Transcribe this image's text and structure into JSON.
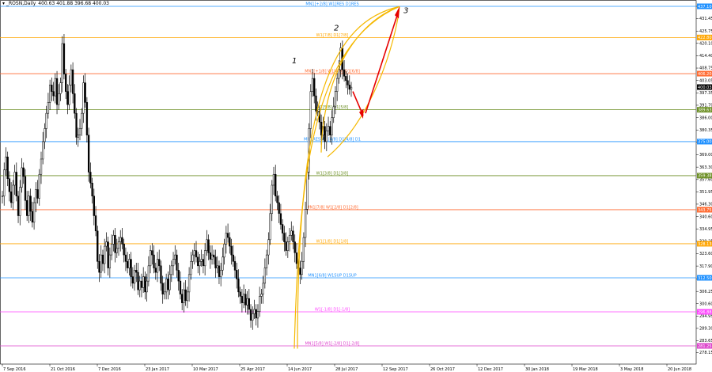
{
  "header": {
    "symbol": "_ROSN,Daily",
    "ohlc": "400.63 401.88 396.68 400.03",
    "arrow_glyph": "▾"
  },
  "chart_data": {
    "type": "candlestick",
    "symbol": "_ROSN",
    "timeframe": "Daily",
    "ylim": [
      272.9,
      440
    ],
    "y_ticks": [
      278.15,
      283.65,
      289.3,
      294.95,
      300.6,
      306.25,
      311.9,
      317.9,
      323.6,
      329.25,
      334.95,
      340.6,
      346.3,
      351.95,
      357.6,
      363.3,
      369.0,
      374.7,
      380.35,
      386.0,
      391.7,
      397.35,
      403.05,
      408.75,
      414.4,
      420.1,
      425.75,
      431.45,
      437.1
    ],
    "y_tick_labels": [
      "278.15",
      "283.65",
      "289.30",
      "294.95",
      "300.60",
      "306.25",
      "311.90",
      "317.90",
      "323.60",
      "329.25",
      "334.95",
      "340.60",
      "346.30",
      "351.95",
      "357.60",
      "363.30",
      "369.00",
      "374.70",
      "380.35",
      "386.00",
      "391.70",
      "397.35",
      "403.05",
      "408.75",
      "414.40",
      "420.10",
      "425.75",
      "431.45",
      "437.10"
    ],
    "x_tick_labels": [
      "7 Sep 2016",
      "21 Oct 2016",
      "7 Dec 2016",
      "23 Jan 2017",
      "10 Mar 2017",
      "25 Apr 2017",
      "14 Jun 2017",
      "28 Jul 2017",
      "12 Sep 2017",
      "26 Oct 2017",
      "12 Dec 2017",
      "30 Jan 2018",
      "19 Mar 2018",
      "3 May 2018",
      "20 Jun 2018"
    ],
    "close_series": [
      350,
      362,
      368,
      358,
      352,
      347,
      355,
      361,
      350,
      341,
      354,
      363,
      359,
      348,
      341,
      350,
      343,
      338,
      347,
      353,
      349,
      360,
      367,
      375,
      381,
      388,
      393,
      401,
      398,
      396,
      404,
      392,
      397,
      402,
      420,
      406,
      398,
      392,
      401,
      408,
      397,
      388,
      377,
      378,
      381,
      388,
      402,
      393,
      378,
      361,
      356,
      350,
      341,
      334,
      320,
      315,
      323,
      319,
      327,
      329,
      317,
      323,
      328,
      332,
      324,
      326,
      329,
      331,
      328,
      323,
      320,
      317,
      321,
      313,
      310,
      316,
      315,
      307,
      311,
      308,
      313,
      306,
      311,
      318,
      325,
      323,
      317,
      315,
      321,
      318,
      310,
      305,
      306,
      312,
      307,
      314,
      318,
      321,
      323,
      316,
      311,
      305,
      301,
      307,
      302,
      306,
      314,
      320,
      323,
      325,
      322,
      318,
      320,
      321,
      318,
      325,
      330,
      324,
      321,
      323,
      322,
      317,
      318,
      313,
      316,
      322,
      328,
      333,
      331,
      327,
      323,
      320,
      316,
      312,
      306,
      304,
      301,
      305,
      300,
      303,
      298,
      293,
      296,
      298,
      294,
      297,
      304,
      305,
      310,
      317,
      323,
      330,
      342,
      355,
      360,
      350,
      347,
      342,
      337,
      333,
      329,
      325,
      329,
      332,
      334,
      329,
      324,
      319,
      317,
      314,
      320,
      331,
      344,
      361,
      381,
      398,
      404,
      396,
      389,
      389,
      384,
      378,
      382,
      375,
      380,
      382,
      378,
      386,
      391,
      398,
      404,
      408,
      418,
      408,
      405,
      403,
      401,
      399,
      400
    ],
    "levels": [
      {
        "label": "MN1[+2/8] W1[RES D1RES",
        "price": 437.1,
        "color": "#1e90ff",
        "price_label": "437.10"
      },
      {
        "label": "W1[7/8] D1[7/8]",
        "price": 422.8,
        "color": "#ffa500",
        "price_label": "422.80"
      },
      {
        "label": "MN1[+1/8] W1[6/8] D1[6/8]",
        "price": 406.2,
        "color": "#ff6a30",
        "price_label": "406.20"
      },
      {
        "label": "W1[5/8] D1[5/8]",
        "price": 389.63,
        "color": "#6b8e23",
        "price_label": "389.63"
      },
      {
        "label": "MN1RES W1[4/8] D1[4/8] D1",
        "price": 375.0,
        "color": "#1e90ff",
        "price_label": "375.00"
      },
      {
        "label": "W1[3/8] D1[3/8]",
        "price": 359.38,
        "color": "#6b8e23",
        "price_label": "359.38"
      },
      {
        "label": "MN1[7/8] W1[2/8] D1[2/8]",
        "price": 343.75,
        "color": "#ff6a30",
        "price_label": "343.75"
      },
      {
        "label": "W1[1/8] D1[1/8]",
        "price": 328.13,
        "color": "#ffa500",
        "price_label": "328.13"
      },
      {
        "label": "MN1[6/8] W1SUP D1SUP",
        "price": 312.5,
        "color": "#1e90ff",
        "price_label": "312.50"
      },
      {
        "label": "W1[-1/8] D1[-1/8]",
        "price": 296.88,
        "color": "#ff44ff",
        "price_label": "296.88"
      },
      {
        "label": "MN1[5/8] W1[-2/8] D1[-2/8]",
        "price": 281.25,
        "color": "#dd44cc",
        "price_label": "281.25"
      }
    ],
    "current_price": {
      "price": 400.03,
      "price_label": "400.03"
    },
    "annotations": {
      "wave1": "1",
      "wave2": "2",
      "wave3": "3"
    },
    "colors": {
      "candles": "#000000",
      "arcs": "#f5b800",
      "arrow": "#e60000",
      "grid": "#d9d9d9"
    }
  }
}
